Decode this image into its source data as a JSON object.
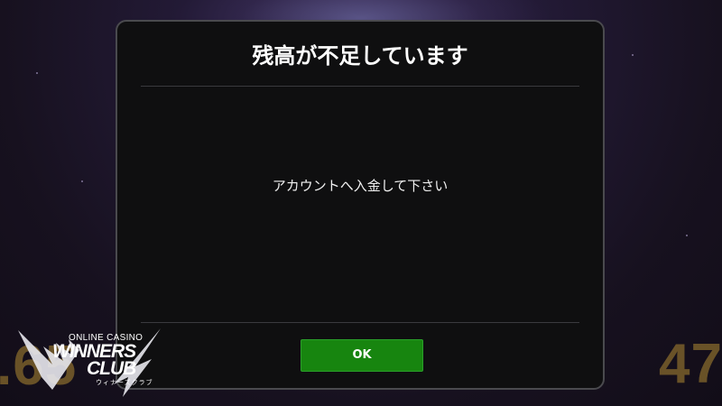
{
  "background": {
    "left_number": ".65",
    "right_number": "47"
  },
  "dialog": {
    "title": "残高が不足しています",
    "message": "アカウントへ入金して下さい",
    "ok_label": "OK",
    "accent_color": "#17850f"
  },
  "logo": {
    "line1": "ONLINE CASINO",
    "line2": "WINNERS",
    "line3": "CLUB",
    "kana": "ウィナーズクラブ"
  }
}
